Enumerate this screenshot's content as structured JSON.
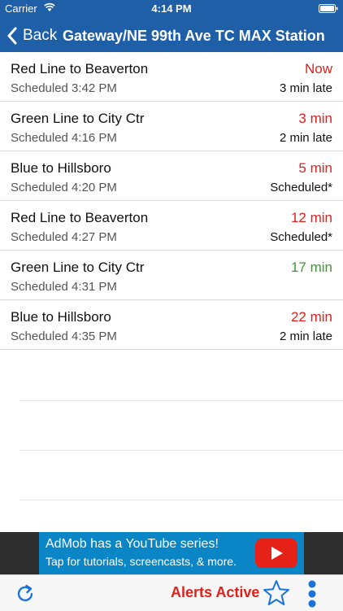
{
  "status_bar": {
    "carrier": "Carrier",
    "time": "4:14 PM"
  },
  "nav": {
    "back_label": "Back",
    "title": "Gateway/NE 99th Ave TC MAX Station"
  },
  "arrivals": [
    {
      "route": "Red Line to Beaverton",
      "scheduled": "Scheduled 3:42 PM",
      "eta": "Now",
      "eta_color": "#e0201a",
      "status": "3 min late"
    },
    {
      "route": "Green Line to City Ctr",
      "scheduled": "Scheduled 4:16 PM",
      "eta": "3 min",
      "eta_color": "#e0201a",
      "status": "2 min late"
    },
    {
      "route": "Blue to Hillsboro",
      "scheduled": "Scheduled 4:20 PM",
      "eta": "5 min",
      "eta_color": "#e0201a",
      "status": "Scheduled*"
    },
    {
      "route": "Red Line to Beaverton",
      "scheduled": "Scheduled 4:27 PM",
      "eta": "12 min",
      "eta_color": "#e0201a",
      "status": "Scheduled*"
    },
    {
      "route": "Green Line to City Ctr",
      "scheduled": "Scheduled 4:31 PM",
      "eta": "17 min",
      "eta_color": "#3a9a2e",
      "status": ""
    },
    {
      "route": "Blue to Hillsboro",
      "scheduled": "Scheduled 4:35 PM",
      "eta": "22 min",
      "eta_color": "#e0201a",
      "status": "2 min late"
    }
  ],
  "ad": {
    "line1": "AdMob has a YouTube series!",
    "line2": "Tap for tutorials, screencasts, & more."
  },
  "toolbar": {
    "alerts_label": "Alerts Active"
  },
  "colors": {
    "nav_bar": "#1f5fa8",
    "accent": "#1a73d9",
    "alert_red": "#e0201a"
  },
  "icons": [
    "wifi-icon",
    "battery-icon",
    "back-chevron-icon",
    "refresh-icon",
    "star-icon",
    "more-vertical-icon",
    "play-icon"
  ]
}
